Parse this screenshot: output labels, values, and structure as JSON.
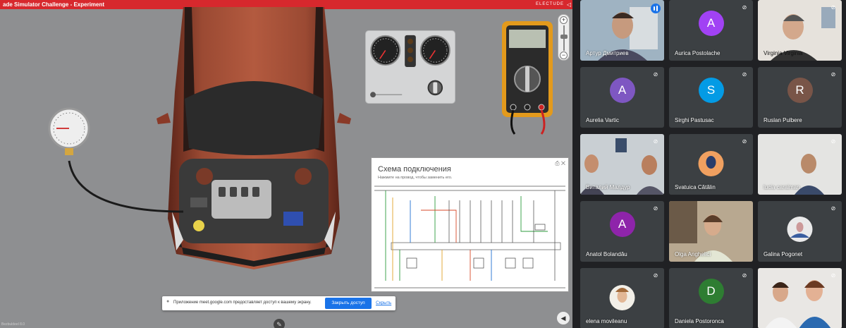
{
  "simulator": {
    "title": "ade Simulator Challenge - Experiment",
    "brand": "ELECTUDE",
    "diagram": {
      "title": "Схема подключения",
      "subtitle": "Нажмите на провод, чтобы заменить его."
    },
    "footer_text": "Bezbuldeel 8.0",
    "share_bar": {
      "message": "Приложение meet.google.com предоставляет доступ к вашему экрану.",
      "stop_label": "Закрыть доступ",
      "hide_label": "Скрыть"
    }
  },
  "participants": [
    {
      "name": "Артур Дмитриев",
      "type": "video",
      "speaking": true,
      "muted": false
    },
    {
      "name": "Aurica Postolache",
      "type": "avatar",
      "initial": "A",
      "color": "#a142f4",
      "muted": true
    },
    {
      "name": "Virginia Virginia",
      "type": "video",
      "muted": true
    },
    {
      "name": "Aurelia Vartic",
      "type": "avatar",
      "initial": "A",
      "color": "#7e57c2",
      "muted": true
    },
    {
      "name": "Sirghi Pastusac",
      "type": "avatar",
      "initial": "S",
      "color": "#039be5",
      "muted": true
    },
    {
      "name": "Ruslan Pulbere",
      "type": "avatar",
      "initial": "R",
      "color": "#795548",
      "muted": true
    },
    {
      "name": "Виталий Малдур",
      "type": "video",
      "muted": true
    },
    {
      "name": "Svatuica Cătălin",
      "type": "photo",
      "muted": true
    },
    {
      "name": "lucia caraiman",
      "type": "video",
      "muted": true
    },
    {
      "name": "Anatol Bolandău",
      "type": "avatar",
      "initial": "A",
      "color": "#8e24aa",
      "muted": true
    },
    {
      "name": "Olga Anghelici",
      "type": "video",
      "muted": true
    },
    {
      "name": "Galina Pogonet",
      "type": "photo",
      "muted": true
    },
    {
      "name": "elena movileanu",
      "type": "photo",
      "muted": true
    },
    {
      "name": "Daniela Postoronca",
      "type": "avatar",
      "initial": "D",
      "color": "#2e7d32",
      "muted": true
    },
    {
      "name": "",
      "type": "video",
      "muted": false
    }
  ],
  "colors": {
    "accent": "#1a73e8",
    "topbar": "#d7282d",
    "car_body": "#8f3f2c",
    "tile_bg": "#3c4043"
  },
  "icons": [
    "mic-off-icon",
    "speaking-icon",
    "zoom-in-icon",
    "zoom-out-icon",
    "pen-icon",
    "volume-icon",
    "pin-icon"
  ]
}
